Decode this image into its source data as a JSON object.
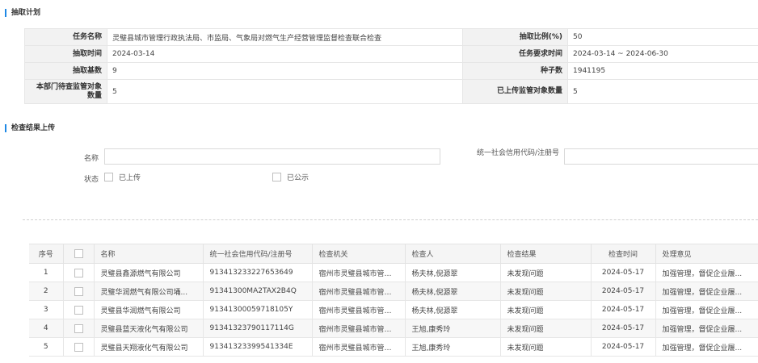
{
  "sections": {
    "plan": "抽取计划",
    "upload": "检查结果上传"
  },
  "plan": {
    "task_name_label": "任务名称",
    "task_name": "灵璧县城市管理行政执法局、市监局、气象局对燃气生产经营管理监督检查联合检查",
    "ratio_label": "抽取比例(%)",
    "ratio": "50",
    "time_label": "抽取时间",
    "time": "2024-03-14",
    "req_time_label": "任务要求时间",
    "req_time": "2024-03-14 ~ 2024-06-30",
    "base_label": "抽取基数",
    "base": "9",
    "seed_label": "种子数",
    "seed": "1941195",
    "pending_label": "本部门待查监管对象数量",
    "pending": "5",
    "uploaded_label": "已上传监管对象数量",
    "uploaded": "5"
  },
  "form": {
    "name_label": "名称",
    "name_value": "",
    "code_label": "统一社会信用代码/注册号",
    "code_value": "",
    "status_label": "状态",
    "opt_uploaded": "已上传",
    "opt_public": "已公示"
  },
  "table": {
    "headers": [
      "序号",
      "",
      "名称",
      "统一社会信用代码/注册号",
      "检查机关",
      "检查人",
      "检查结果",
      "检查时间",
      "处理意见"
    ],
    "rows": [
      [
        "1",
        "灵璧县鑫源燃气有限公司",
        "913413233227653649",
        "宿州市灵璧县城市管理...",
        "杨夫林,倪源翠",
        "未发现问题",
        "2024-05-17",
        "加强管理，督促企业履..."
      ],
      [
        "2",
        "灵璧华润燃气有限公司埇...",
        "91341300MA2TAX2B4Q",
        "宿州市灵璧县城市管理...",
        "杨夫林,倪源翠",
        "未发现问题",
        "2024-05-17",
        "加强管理，督促企业履..."
      ],
      [
        "3",
        "灵璧县华润燃气有限公司",
        "91341300059718105Y",
        "宿州市灵璧县城市管理...",
        "杨夫林,倪源翠",
        "未发现问题",
        "2024-05-17",
        "加强管理，督促企业履..."
      ],
      [
        "4",
        "灵璧县蓝天液化气有限公司",
        "91341323790117114G",
        "宿州市灵璧县城市管理...",
        "王旭,康秀玲",
        "未发现问题",
        "2024-05-17",
        "加强管理，督促企业履..."
      ],
      [
        "5",
        "灵璧县天翔液化气有限公司",
        "91341323399541334E",
        "宿州市灵璧县城市管理...",
        "王旭,康秀玲",
        "未发现问题",
        "2024-05-17",
        "加强管理，督促企业履..."
      ]
    ]
  }
}
